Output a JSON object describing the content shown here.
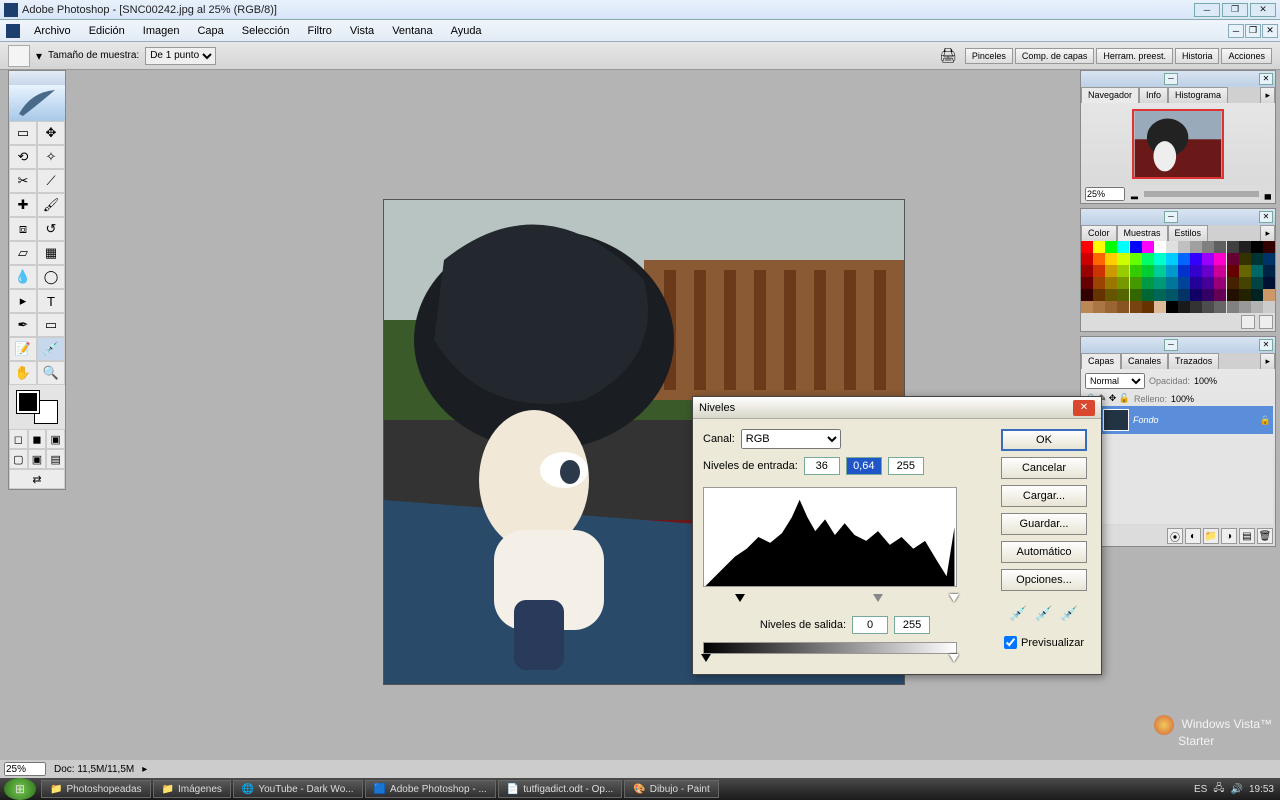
{
  "title": "Adobe Photoshop - [SNC00242.jpg al 25% (RGB/8)]",
  "menu": [
    "Archivo",
    "Edición",
    "Imagen",
    "Capa",
    "Selección",
    "Filtro",
    "Vista",
    "Ventana",
    "Ayuda"
  ],
  "optionsbar": {
    "sample_label": "Tamaño de muestra:",
    "sample_value": "De 1 punto"
  },
  "palette_tabs": [
    "Pinceles",
    "Comp. de capas",
    "Herram. preest.",
    "Historia",
    "Acciones"
  ],
  "navigator": {
    "tabs": [
      "Navegador",
      "Info",
      "Histograma"
    ],
    "zoom": "25%"
  },
  "swatches": {
    "tabs": [
      "Color",
      "Muestras",
      "Estilos"
    ],
    "colors": [
      "#ff0000",
      "#ffff00",
      "#00ff00",
      "#00ffff",
      "#0000ff",
      "#ff00ff",
      "#ffffff",
      "#e0e0e0",
      "#c0c0c0",
      "#a0a0a0",
      "#808080",
      "#606060",
      "#404040",
      "#202020",
      "#000000",
      "#330000",
      "#cc0000",
      "#ff6600",
      "#ffcc00",
      "#ccff00",
      "#66ff00",
      "#00ff66",
      "#00ffcc",
      "#00ccff",
      "#0066ff",
      "#3300ff",
      "#9900ff",
      "#ff00cc",
      "#660033",
      "#333300",
      "#003333",
      "#003366",
      "#990000",
      "#cc3300",
      "#cc9900",
      "#99cc00",
      "#33cc00",
      "#00cc33",
      "#00cc99",
      "#0099cc",
      "#0033cc",
      "#3300cc",
      "#6600cc",
      "#cc0099",
      "#660000",
      "#666600",
      "#006666",
      "#002244",
      "#660000",
      "#994400",
      "#997700",
      "#779900",
      "#449900",
      "#009944",
      "#009977",
      "#007799",
      "#004499",
      "#220099",
      "#440099",
      "#990077",
      "#442200",
      "#444400",
      "#004444",
      "#001133",
      "#330000",
      "#663300",
      "#665500",
      "#556600",
      "#336600",
      "#006633",
      "#006655",
      "#005566",
      "#003366",
      "#110066",
      "#330066",
      "#660055",
      "#221100",
      "#222200",
      "#002222",
      "#cc9966",
      "#bb8855",
      "#aa7744",
      "#996633",
      "#885522",
      "#774411",
      "#663300",
      "#ddbb99",
      "#000000",
      "#1a1a1a",
      "#333333",
      "#4d4d4d",
      "#666666",
      "#808080",
      "#999999",
      "#b3b3b3",
      "#cccccc"
    ]
  },
  "layers": {
    "tabs": [
      "Capas",
      "Canales",
      "Trazados"
    ],
    "blend": "Normal",
    "opacity_label": "Opacidad:",
    "opacity": "100%",
    "fill_label": "Relleno:",
    "fill": "100%",
    "layer_name": "Fondo"
  },
  "dialog": {
    "title": "Niveles",
    "channel_label": "Canal:",
    "channel": "RGB",
    "input_label": "Niveles de entrada:",
    "in_black": "36",
    "in_gamma": "0,64",
    "in_white": "255",
    "output_label": "Niveles de salida:",
    "out_black": "0",
    "out_white": "255",
    "buttons": {
      "ok": "OK",
      "cancel": "Cancelar",
      "load": "Cargar...",
      "save": "Guardar...",
      "auto": "Automático",
      "options": "Opciones..."
    },
    "preview": "Previsualizar"
  },
  "status": {
    "zoom": "25%",
    "doc": "Doc: 11,5M/11,5M"
  },
  "taskbar": {
    "items": [
      "Photoshopeadas",
      "Imágenes",
      "YouTube - Dark Wo...",
      "Adobe Photoshop - ...",
      "tutfigadict.odt - Op...",
      "Dibujo - Paint"
    ],
    "lang": "ES",
    "time": "19:53"
  },
  "watermark": {
    "l1": "Windows Vista™",
    "l2": "Starter"
  }
}
